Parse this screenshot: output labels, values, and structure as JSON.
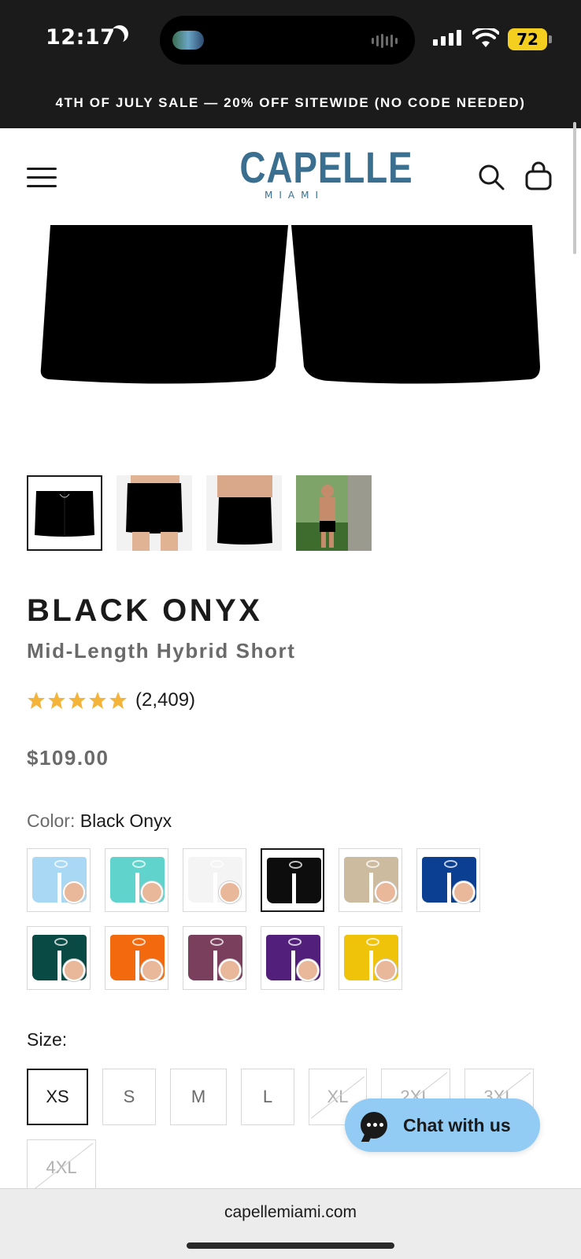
{
  "status_bar": {
    "time": "12:17",
    "battery": "72"
  },
  "promo_banner": "4TH OF JULY SALE — 20% OFF SITEWIDE (NO CODE NEEDED)",
  "header": {
    "logo_main": "CAPELLE",
    "logo_sub": "MIAMI",
    "brand_color": "#3b6f8f"
  },
  "product": {
    "title": "BLACK ONYX",
    "subtitle": "Mid-Length Hybrid Short",
    "rating_stars": 5,
    "rating_count": "(2,409)",
    "price": "$109.00",
    "color_label": "Color:",
    "color_value": "Black Onyx",
    "size_label": "Size:"
  },
  "thumbnails": [
    {
      "name": "front-flat",
      "active": true
    },
    {
      "name": "front-model",
      "active": false
    },
    {
      "name": "back-model",
      "active": false
    },
    {
      "name": "lifestyle-tree",
      "active": false
    }
  ],
  "colors": [
    {
      "hex": "#a9d8f5",
      "active": false
    },
    {
      "hex": "#5fd3cc",
      "active": false
    },
    {
      "hex": "#f4f4f4",
      "active": false
    },
    {
      "hex": "#0d0d0d",
      "active": true
    },
    {
      "hex": "#cdbba0",
      "active": false
    },
    {
      "hex": "#0a3f92",
      "active": false
    },
    {
      "hex": "#0a4a44",
      "active": false
    },
    {
      "hex": "#f36a0e",
      "active": false
    },
    {
      "hex": "#7a3f5c",
      "active": false
    },
    {
      "hex": "#52207a",
      "active": false
    },
    {
      "hex": "#efc30a",
      "active": false
    }
  ],
  "sizes": [
    {
      "label": "XS",
      "active": true,
      "available": true
    },
    {
      "label": "S",
      "active": false,
      "available": true
    },
    {
      "label": "M",
      "active": false,
      "available": true
    },
    {
      "label": "L",
      "active": false,
      "available": true
    },
    {
      "label": "XL",
      "active": false,
      "available": false
    },
    {
      "label": "2XL",
      "active": false,
      "available": false
    },
    {
      "label": "3XL",
      "active": false,
      "available": false
    },
    {
      "label": "4XL",
      "active": false,
      "available": false
    }
  ],
  "chat": {
    "label": "Chat with us"
  },
  "browser": {
    "url": "capellemiami.com"
  },
  "accent_colors": {
    "star": "#f4b43a",
    "chat_bg": "#92cbf3"
  }
}
